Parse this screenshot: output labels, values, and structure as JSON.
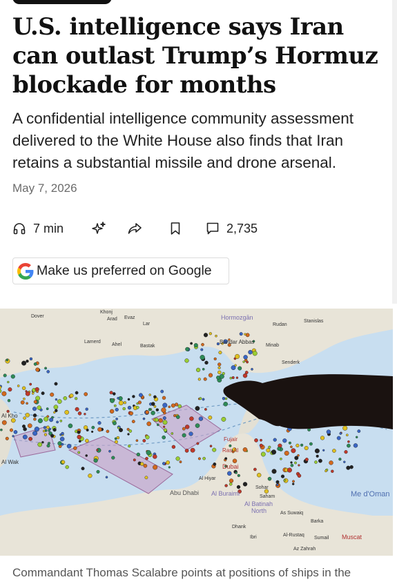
{
  "article": {
    "headline": "U.S. intelligence says Iran can outlast Trump’s Hormuz blockade for months",
    "dek": "A confidential intelligence community assessment delivered to the White House also finds that Iran retains a substantial missile and drone arsenal.",
    "date": "May 7, 2026"
  },
  "actions": {
    "listen_label": "7 min",
    "comments_count": "2,735"
  },
  "google_button": {
    "label": "Make us preferred on Google"
  },
  "photo": {
    "caption": "Commandant Thomas Scalabre points at positions of ships in the",
    "map_labels": {
      "hormozgan": "Hormozgān",
      "bandar_abbas": "Bandar Abbas",
      "abu_dhabi": "Abu Dhabi",
      "al_buraimi": "Al Buraimi",
      "dubai": "Dubai",
      "ras_al": "Ras Al",
      "sohar": "Sohar",
      "al_batinah": "Al Batinah",
      "north": "North",
      "as_suwaiq": "As Suwaiq",
      "barka": "Barka",
      "al_rustaq": "Al-Rustaq",
      "muscat": "Muscat",
      "gulf_of_oman": "Me d'Oman",
      "al_khor": "Al Kho",
      "al_wak": "Al Wak",
      "minab": "Minab",
      "senderk": "Senderk",
      "ahel": "Ahel",
      "bastak": "Bastak",
      "lamerd": "Lamerd",
      "rudan": "Rudan",
      "stanislas": "Stanislas",
      "lar": "Lar",
      "evaz": "Evaz",
      "arad": "Arad",
      "khonj": "Khonj",
      "dover": "Dover",
      "ibri": "Ibri",
      "dhank": "Dhank",
      "az_zahrah": "Az Zahrah",
      "fujair": "Fujair",
      "al_hiyar": "Al Hiyar",
      "saham": "Saham",
      "sumail": "Sumail"
    }
  },
  "colors": {
    "text": "#111111",
    "muted": "#6b6b6b",
    "map_sea": "#c8def0",
    "map_land": "#eceae3",
    "zone_fill": "#c9a3c8"
  }
}
